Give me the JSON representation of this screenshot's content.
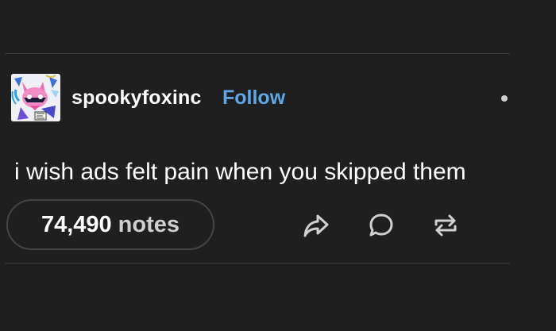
{
  "post": {
    "username": "spookyfoxinc",
    "follow_label": "Follow",
    "text": "i wish ads felt pain when you skipped them",
    "notes_count": "74,490",
    "notes_label": "notes"
  },
  "icons": {
    "avatar": "fox-character-avatar",
    "more": "more-options-icon",
    "share": "share-icon",
    "reply": "reply-icon",
    "reblog": "reblog-icon"
  },
  "colors": {
    "background": "#1f1f1f",
    "follow": "#5fa8e8",
    "divider": "#3a3a3a",
    "text": "#ffffff",
    "muted": "#cfcfcf"
  }
}
